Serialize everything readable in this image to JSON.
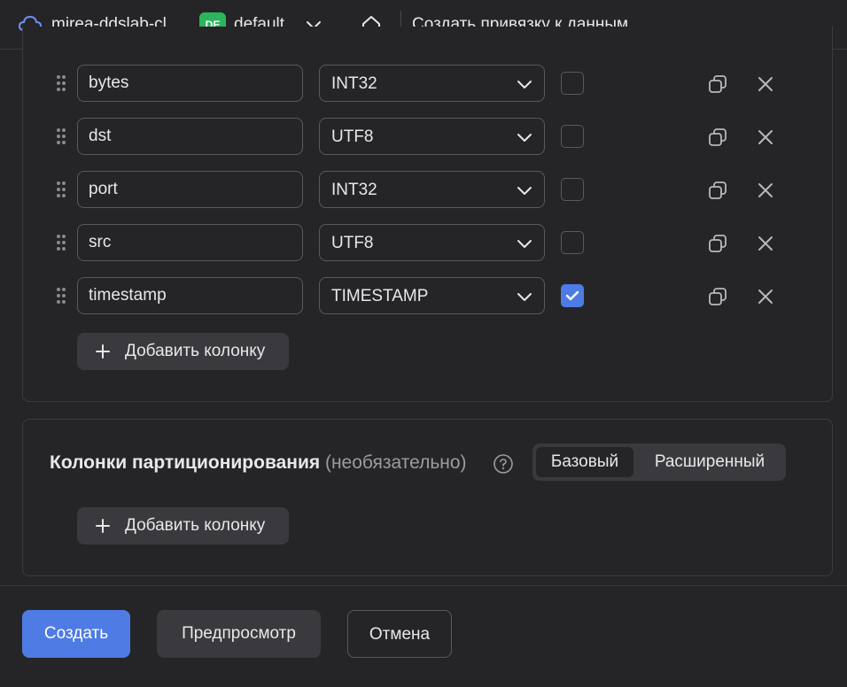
{
  "header": {
    "cloud_name": "mirea-ddslab-cl...",
    "folder_badge": "DE",
    "folder_name": "default",
    "page_title": "Создать привязку к данным",
    "cloud_icon": "cloud-icon",
    "home_icon": "home-icon"
  },
  "columns": [
    {
      "name": "bytes",
      "type": "INT32",
      "checked": false
    },
    {
      "name": "dst",
      "type": "UTF8",
      "checked": false
    },
    {
      "name": "port",
      "type": "INT32",
      "checked": false
    },
    {
      "name": "src",
      "type": "UTF8",
      "checked": false
    },
    {
      "name": "timestamp",
      "type": "TIMESTAMP",
      "checked": true
    }
  ],
  "add_column_label": "Добавить колонку",
  "partition": {
    "title": "Колонки партиционирования",
    "optional": "(необязательно)",
    "mode_basic": "Базовый",
    "mode_advanced": "Расширенный",
    "active_mode": "basic",
    "add_column_label": "Добавить колонку"
  },
  "footer": {
    "create_label": "Создать",
    "preview_label": "Предпросмотр",
    "cancel_label": "Отмена"
  },
  "colors": {
    "accent": "#4e7be4",
    "badge": "#2db55d",
    "background": "#252528"
  }
}
